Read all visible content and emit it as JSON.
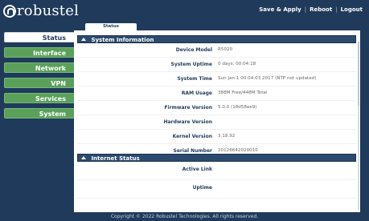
{
  "header": {
    "logo_text": "robustel",
    "nav": [
      "Save & Apply",
      "Reboot",
      "Logout"
    ]
  },
  "tab": {
    "label": "Status"
  },
  "sidebar": {
    "items": [
      {
        "label": "Status"
      },
      {
        "label": "Interface"
      },
      {
        "label": "Network"
      },
      {
        "label": "VPN"
      },
      {
        "label": "Services"
      },
      {
        "label": "System"
      }
    ]
  },
  "system_info": {
    "title": "System Information",
    "rows": [
      {
        "label": "Device Model",
        "value": "R5020"
      },
      {
        "label": "System Uptime",
        "value": "0 days, 00:04:18"
      },
      {
        "label": "System Time",
        "value": "Sun Jan 1 00:04:03 2017 (NTP not updated)"
      },
      {
        "label": "RAM Usage",
        "value": "388M Free/448M Total"
      },
      {
        "label": "Firmware Version",
        "value": "5.0.0 (18d58ee9)"
      },
      {
        "label": "Hardware Version",
        "value": ""
      },
      {
        "label": "Kernel Version",
        "value": "3.18.92"
      },
      {
        "label": "Serial Number",
        "value": "20126642020010"
      }
    ]
  },
  "internet_status": {
    "title": "Internet Status",
    "rows": [
      {
        "label": "Active Link",
        "value": ""
      },
      {
        "label": "Uptime",
        "value": ""
      }
    ]
  },
  "footer": {
    "text": "Copyright © 2022 Robustel Technologies. All rights reserved."
  },
  "colors": {
    "header_bg": "#1f3a5a",
    "panel_head": "#2c4a6e",
    "sidebar_green": "#5aa05a"
  }
}
